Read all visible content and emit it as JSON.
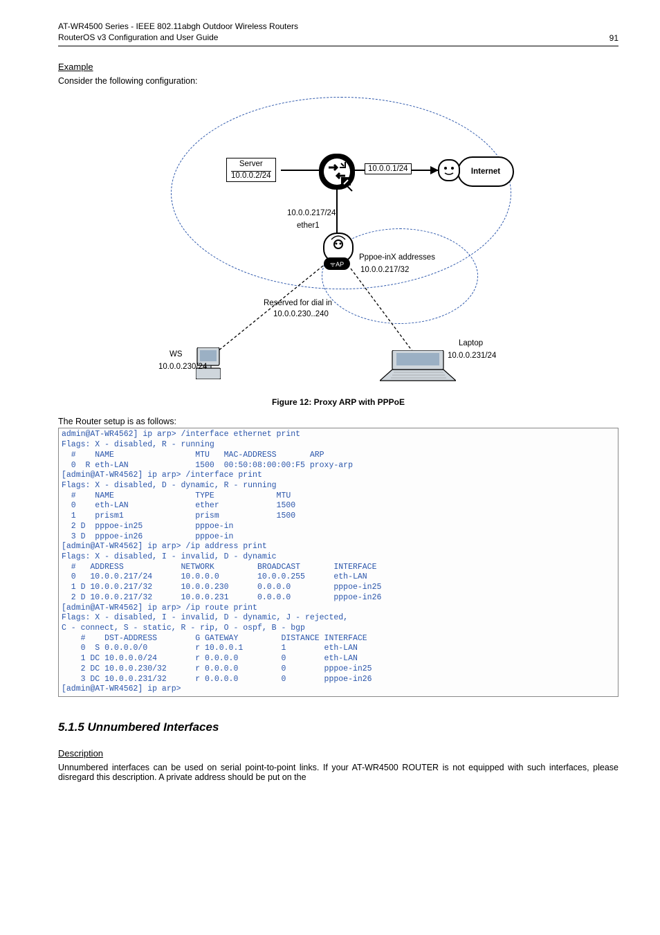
{
  "header": {
    "line1": "AT-WR4500 Series - IEEE 802.11abgh Outdoor Wireless Routers",
    "line2": "RouterOS v3 Configuration and User Guide",
    "page_number": "91"
  },
  "sections": {
    "example_heading": "Example",
    "example_intro": "Consider the following configuration:",
    "figure_caption": "Figure 12: Proxy ARP with PPPoE",
    "follows_text": "The Router setup is as follows:",
    "sub_heading": "5.1.5  Unnumbered Interfaces",
    "desc_heading": "Description",
    "desc_body": "Unnumbered interfaces can be used on serial point-to-point links. If your AT-WR4500 ROUTER is not equipped with such interfaces, please disregard this description. A private address should be put on the"
  },
  "diagram": {
    "server_word": "Server",
    "server_ip": "10.0.0.2/24",
    "net_ip": "10.0.0.1/24",
    "internet": "Internet",
    "trunk_ip": "10.0.0.217/24",
    "ether1": "ether1",
    "pppoe_line": "Pppoe-inX addresses",
    "pppoe_ip": "10.0.0.217/32",
    "reserved1": "Reserved for dial in",
    "reserved2": "10.0.0.230..240",
    "laptop_name": "Laptop",
    "laptop_ip": "10.0.0.231/24",
    "ws_name": "WS",
    "ws_ip": "10.0.0.230/24"
  },
  "code": "admin@AT-WR4562] ip arp> /interface ethernet print\nFlags: X - disabled, R - running\n  #    NAME                 MTU   MAC-ADDRESS       ARP\n  0  R eth-LAN              1500  00:50:08:00:00:F5 proxy-arp\n[admin@AT-WR4562] ip arp> /interface print\nFlags: X - disabled, D - dynamic, R - running\n  #    NAME                 TYPE             MTU\n  0    eth-LAN              ether            1500\n  1    prism1               prism            1500\n  2 D  pppoe-in25           pppoe-in\n  3 D  pppoe-in26           pppoe-in\n[admin@AT-WR4562] ip arp> /ip address print\nFlags: X - disabled, I - invalid, D - dynamic\n  #   ADDRESS            NETWORK         BROADCAST       INTERFACE\n  0   10.0.0.217/24      10.0.0.0        10.0.0.255      eth-LAN\n  1 D 10.0.0.217/32      10.0.0.230      0.0.0.0         pppoe-in25\n  2 D 10.0.0.217/32      10.0.0.231      0.0.0.0         pppoe-in26\n[admin@AT-WR4562] ip arp> /ip route print\nFlags: X - disabled, I - invalid, D - dynamic, J - rejected,\nC - connect, S - static, R - rip, O - ospf, B - bgp\n    #    DST-ADDRESS        G GATEWAY         DISTANCE INTERFACE\n    0  S 0.0.0.0/0          r 10.0.0.1        1        eth-LAN\n    1 DC 10.0.0.0/24        r 0.0.0.0         0        eth-LAN\n    2 DC 10.0.0.230/32      r 0.0.0.0         0        pppoe-in25\n    3 DC 10.0.0.231/32      r 0.0.0.0         0        pppoe-in26\n[admin@AT-WR4562] ip arp>"
}
